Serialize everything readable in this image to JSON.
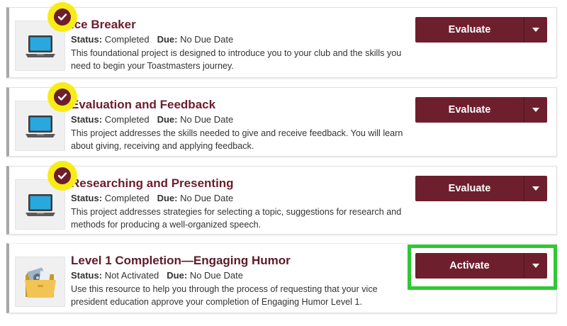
{
  "labels": {
    "status": "Status:",
    "due": "Due:"
  },
  "colors": {
    "brand_maroon": "#6e1f2e",
    "highlight_yellow": "#f8ec16",
    "highlight_green": "#2ec932"
  },
  "projects": [
    {
      "title": "Ice Breaker",
      "status": "Completed",
      "due": "No Due Date",
      "description": "This foundational project is designed to introduce you to your club and the skills you need to begin your Toastmasters journey.",
      "button_label": "Evaluate",
      "icon": "laptop-icon",
      "completed_badge": true
    },
    {
      "title": "Evaluation and Feedback",
      "status": "Completed",
      "due": "No Due Date",
      "description": "This project addresses the skills needed to give and receive feedback. You will learn about giving, receiving and applying feedback.",
      "button_label": "Evaluate",
      "icon": "laptop-icon",
      "completed_badge": true
    },
    {
      "title": "Researching and Presenting",
      "status": "Completed",
      "due": "No Due Date",
      "description": "This project addresses strategies for selecting a topic, suggestions for research and methods for producing a well-organized speech.",
      "button_label": "Evaluate",
      "icon": "laptop-icon",
      "completed_badge": true
    },
    {
      "title": "Level 1 Completion—Engaging Humor",
      "status": "Not Activated",
      "due": "No Due Date",
      "description": "Use this resource to help you through the process of requesting that your vice president education approve your completion of Engaging Humor Level 1.",
      "button_label": "Activate",
      "icon": "folder-icon",
      "completed_badge": false
    }
  ]
}
